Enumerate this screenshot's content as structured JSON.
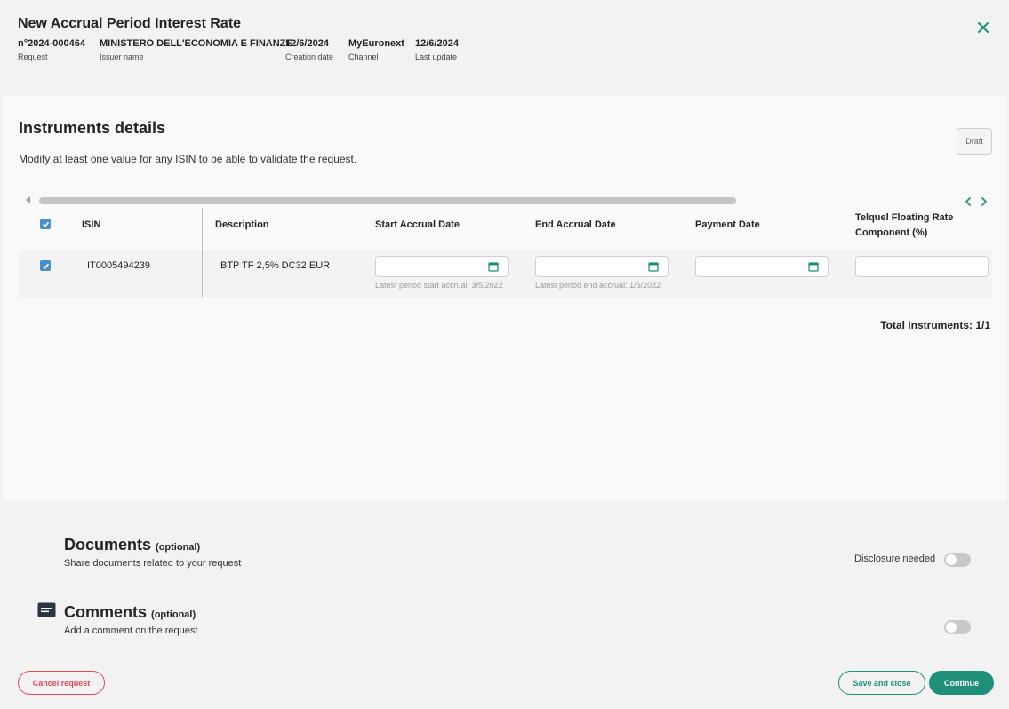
{
  "header": {
    "title": "New Accrual Period Interest Rate",
    "meta": [
      {
        "value": "n°2024-000464",
        "label": "Request"
      },
      {
        "value": "MINISTERO DELL'ECONOMIA E FINANZE",
        "label": "Issuer name"
      },
      {
        "value": "12/6/2024",
        "label": "Creation date"
      },
      {
        "value": "MyEuronext",
        "label": "Channel"
      },
      {
        "value": "12/6/2024",
        "label": "Last update"
      }
    ]
  },
  "instruments": {
    "title": "Instruments details",
    "subtitle": "Modify at least one value for any ISIN to be able to validate the request.",
    "status_badge": "Draft",
    "columns": {
      "isin": "ISIN",
      "description": "Description",
      "start_accrual": "Start Accrual Date",
      "end_accrual": "End Accrual Date",
      "payment_date": "Payment Date",
      "telquel_line1": "Telquel Floating Rate",
      "telquel_line2": "Component (%)"
    },
    "rows": [
      {
        "isin": "IT0005494239",
        "description": "BTP TF 2,5% DC32 EUR",
        "start_hint": "Latest period start accrual: 3/5/2022",
        "end_hint": "Latest period end accrual: 1/6/2022"
      }
    ],
    "total": "Total Instruments: 1/1"
  },
  "documents": {
    "title": "Documents",
    "optional": "(optional)",
    "subtitle": "Share documents related to your request",
    "disclosure_label": "Disclosure needed"
  },
  "comments": {
    "title": "Comments",
    "optional": "(optional)",
    "subtitle": "Add a comment on the request"
  },
  "footer": {
    "cancel": "Cancel request",
    "save": "Save and close",
    "continue": "Continue"
  },
  "colors": {
    "accent": "#1f8f7a",
    "danger": "#e04a5a",
    "checkbox": "#4a90c8"
  },
  "icons": [
    "close-icon",
    "calendar-icon",
    "checkbox-icon",
    "chevron-left-icon",
    "chevron-right-icon",
    "comment-icon"
  ]
}
